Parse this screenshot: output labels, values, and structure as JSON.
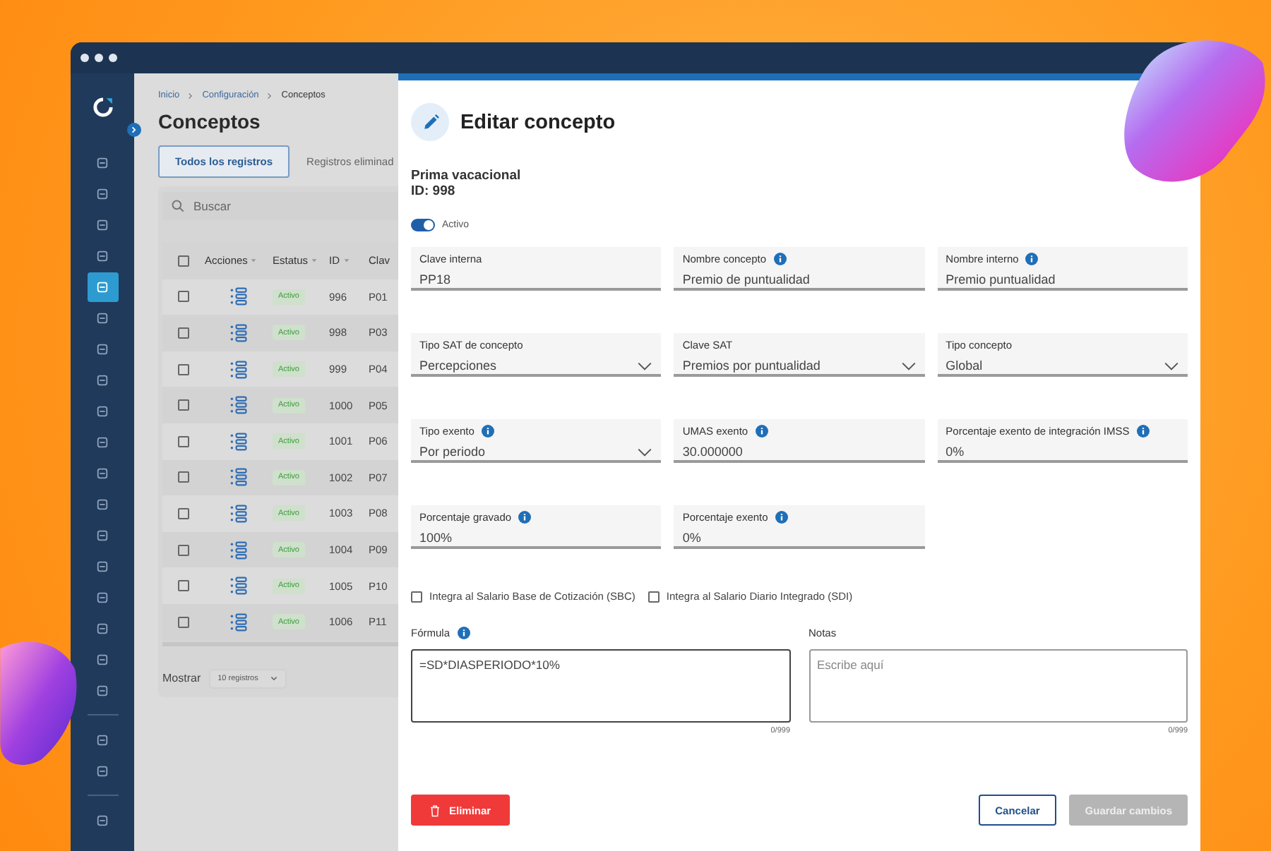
{
  "sidebar": {
    "groups": [
      [
        {
          "selected": false
        },
        {
          "selected": false
        },
        {
          "selected": false
        },
        {
          "selected": false
        },
        {
          "selected": true
        },
        {
          "selected": false
        },
        {
          "selected": false
        },
        {
          "selected": false
        },
        {
          "selected": false
        },
        {
          "selected": false
        },
        {
          "selected": false
        },
        {
          "selected": false
        },
        {
          "selected": false
        },
        {
          "selected": false
        },
        {
          "selected": false
        },
        {
          "selected": false
        },
        {
          "selected": false
        },
        {
          "selected": false
        }
      ],
      [
        {
          "selected": false
        },
        {
          "selected": false
        }
      ],
      [
        {
          "selected": false
        }
      ]
    ]
  },
  "breadcrumb": [
    {
      "label": "Inicio",
      "current": false
    },
    {
      "label": "Configuración",
      "current": false
    },
    {
      "label": "Conceptos",
      "current": true
    }
  ],
  "page_title": "Conceptos",
  "tabs": [
    {
      "label": "Todos los registros",
      "selected": true
    },
    {
      "label": "Registros eliminad",
      "selected": false
    }
  ],
  "search": {
    "placeholder": "Buscar"
  },
  "table": {
    "all_checked": false,
    "columns": [
      "Acciones",
      "Estatus",
      "ID",
      "Clav"
    ],
    "rows": [
      {
        "checked": false,
        "status": "Activo",
        "id": "996",
        "clave": "P01"
      },
      {
        "checked": false,
        "status": "Activo",
        "id": "998",
        "clave": "P03"
      },
      {
        "checked": false,
        "status": "Activo",
        "id": "999",
        "clave": "P04"
      },
      {
        "checked": false,
        "status": "Activo",
        "id": "1000",
        "clave": "P05"
      },
      {
        "checked": false,
        "status": "Activo",
        "id": "1001",
        "clave": "P06"
      },
      {
        "checked": false,
        "status": "Activo",
        "id": "1002",
        "clave": "P07"
      },
      {
        "checked": false,
        "status": "Activo",
        "id": "1003",
        "clave": "P08"
      },
      {
        "checked": false,
        "status": "Activo",
        "id": "1004",
        "clave": "P09"
      },
      {
        "checked": false,
        "status": "Activo",
        "id": "1005",
        "clave": "P10"
      },
      {
        "checked": false,
        "status": "Activo",
        "id": "1006",
        "clave": "P11"
      }
    ]
  },
  "pagination": {
    "label": "Mostrar",
    "page_size": "10 registros"
  },
  "drawer": {
    "title": "Editar concepto",
    "concept_name": "Prima vacacional",
    "concept_id": "ID: 998",
    "active_toggle": {
      "label": "Activo",
      "on": true
    },
    "field_rows": [
      [
        {
          "kind": "text",
          "label": "Clave interna",
          "info": false,
          "value": "PP18"
        },
        {
          "kind": "text",
          "label": "Nombre concepto",
          "info": true,
          "value": "Premio de puntualidad"
        },
        {
          "kind": "text",
          "label": "Nombre interno",
          "info": true,
          "value": "Premio puntualidad"
        }
      ],
      [
        {
          "kind": "select",
          "label": "Tipo SAT de concepto",
          "info": false,
          "value": "Percepciones"
        },
        {
          "kind": "select",
          "label": "Clave SAT",
          "info": false,
          "value": "Premios por puntualidad"
        },
        {
          "kind": "select",
          "label": "Tipo concepto",
          "info": false,
          "value": "Global"
        }
      ],
      [
        {
          "kind": "select",
          "label": "Tipo exento",
          "info": true,
          "value": "Por periodo"
        },
        {
          "kind": "text",
          "label": "UMAS exento",
          "info": true,
          "value": "30.000000"
        },
        {
          "kind": "text",
          "label": "Porcentaje exento de integración IMSS",
          "info": true,
          "value": "0%"
        }
      ],
      [
        {
          "kind": "text",
          "label": "Porcentaje gravado",
          "info": true,
          "value": "100%"
        },
        {
          "kind": "text",
          "label": "Porcentaje exento",
          "info": true,
          "value": "0%"
        }
      ]
    ],
    "checkboxes": [
      {
        "label": "Integra al Salario Base de Cotización (SBC)",
        "checked": false
      },
      {
        "label": "Integra al Salario Diario Integrado (SDI)",
        "checked": false
      }
    ],
    "text_areas": [
      {
        "label": "Fórmula",
        "info": true,
        "value": "=SD*DIASPERIODO*10%",
        "counter": "0/999"
      },
      {
        "label": "Notas",
        "info": false,
        "placeholder": "Escribe aquí",
        "counter": "0/999"
      }
    ],
    "buttons": {
      "delete": "Eliminar",
      "cancel": "Cancelar",
      "save": "Guardar cambios"
    }
  }
}
